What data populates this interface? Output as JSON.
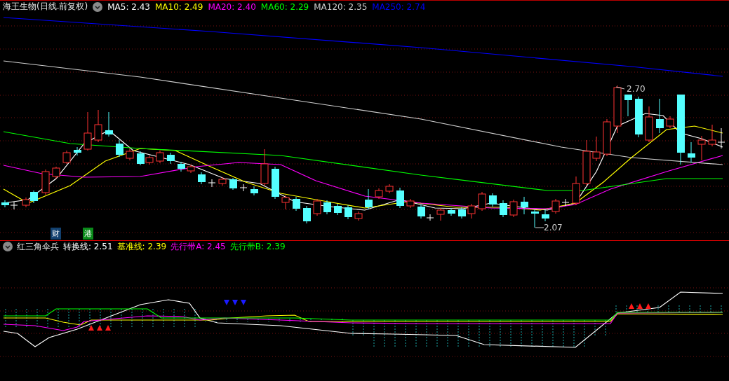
{
  "main_panel": {
    "title": "海王生物(日线.前复权)",
    "legend": [
      {
        "label": "MA5: 2.43",
        "color": "#ffffff"
      },
      {
        "label": "MA10: 2.49",
        "color": "#ffff00"
      },
      {
        "label": "MA20: 2.40",
        "color": "#ff00ff"
      },
      {
        "label": "MA60: 2.29",
        "color": "#00ff00"
      },
      {
        "label": "MA120: 2.35",
        "color": "#d0d0d0"
      },
      {
        "label": "MA250: 2.74",
        "color": "#0000ff"
      }
    ],
    "high_label": "2.70",
    "low_label": "2.07",
    "markers": [
      {
        "label": "财",
        "color": "#12406e"
      },
      {
        "label": "港",
        "color": "#0a8a1a"
      }
    ]
  },
  "indicator_panel": {
    "title": "红三角伞兵",
    "legend": [
      {
        "label": "转换线: 2.51",
        "color": "#ffffff"
      },
      {
        "label": "基准线: 2.39",
        "color": "#ffff00"
      },
      {
        "label": "先行带A: 2.45",
        "color": "#ff00ff"
      },
      {
        "label": "先行带B: 2.39",
        "color": "#00ff00"
      }
    ]
  }
}
